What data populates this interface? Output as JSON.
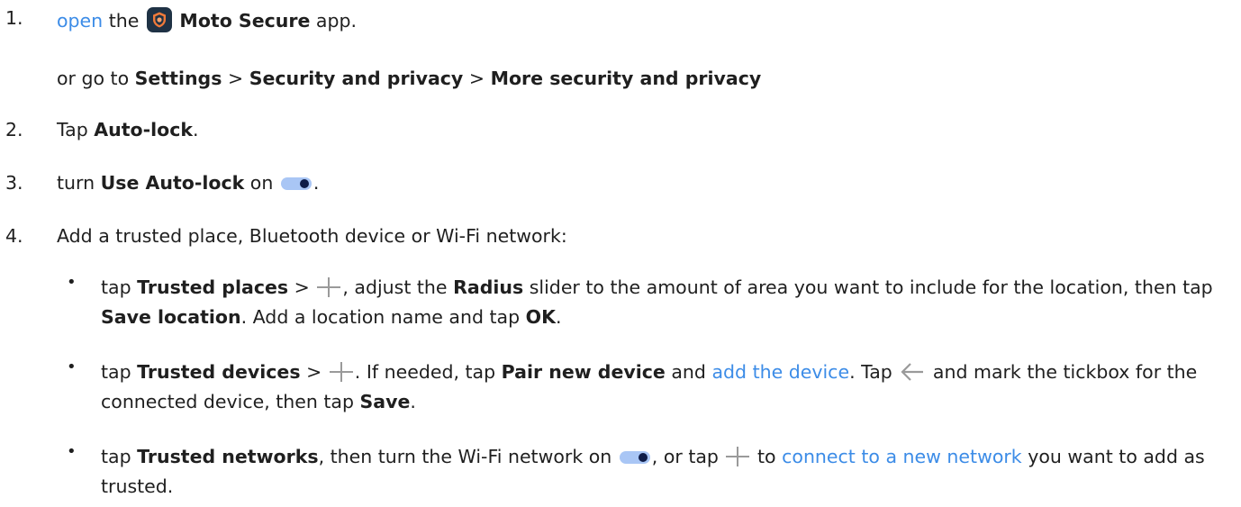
{
  "step1": {
    "number": "1.",
    "link": "open",
    "pre": "the",
    "app_name": "Moto Secure",
    "post": "app.",
    "alt_prefix": "or go to",
    "path1": "Settings",
    "sep1": ">",
    "path2": "Security and privacy",
    "sep2": ">",
    "path3": "More security and privacy"
  },
  "step2": {
    "number": "2.",
    "pre": "Tap",
    "bold": "Auto-lock",
    "post": "."
  },
  "step3": {
    "number": "3.",
    "pre": "turn",
    "bold": "Use Auto-lock",
    "mid": "on",
    "post": "."
  },
  "step4": {
    "number": "4.",
    "text": "Add a trusted place, Bluetooth device or Wi-Fi network:",
    "bullet": "•",
    "b1": {
      "t1": "tap",
      "b_places": "Trusted places",
      "sep": ">",
      "t2": ", adjust the",
      "b_radius": "Radius",
      "t3": "slider to the amount of area you want to include for the location, then tap",
      "b_save_location": "Save location",
      "t4": ". Add a location name and tap",
      "b_ok": "OK",
      "t5": "."
    },
    "b2": {
      "t1": "tap",
      "b_devices": "Trusted devices",
      "sep": ">",
      "t2": ". If needed, tap",
      "b_pair": "Pair new device",
      "t3": "and",
      "link": "add the device",
      "t4": ". Tap",
      "t5": "and mark the tickbox for the connected device, then tap",
      "b_save": "Save",
      "t6": "."
    },
    "b3": {
      "t1": "tap",
      "b_networks": "Trusted networks",
      "t2": ", then turn the Wi-Fi network on",
      "t3": ", or tap",
      "t4": "to",
      "link": "connect to a new network",
      "t5": "you want to add as trusted."
    }
  },
  "icons": {
    "app_icon": "moto-secure-shield-icon",
    "toggle": "toggle-on-icon",
    "plus": "plus-icon",
    "back": "back-arrow-icon"
  },
  "colors": {
    "link": "#3c8ce7",
    "text": "#1f1f1f",
    "toggle_track": "#a9c6f5",
    "toggle_knob": "#0e1c48",
    "app_icon_bg": "#1f3245"
  }
}
